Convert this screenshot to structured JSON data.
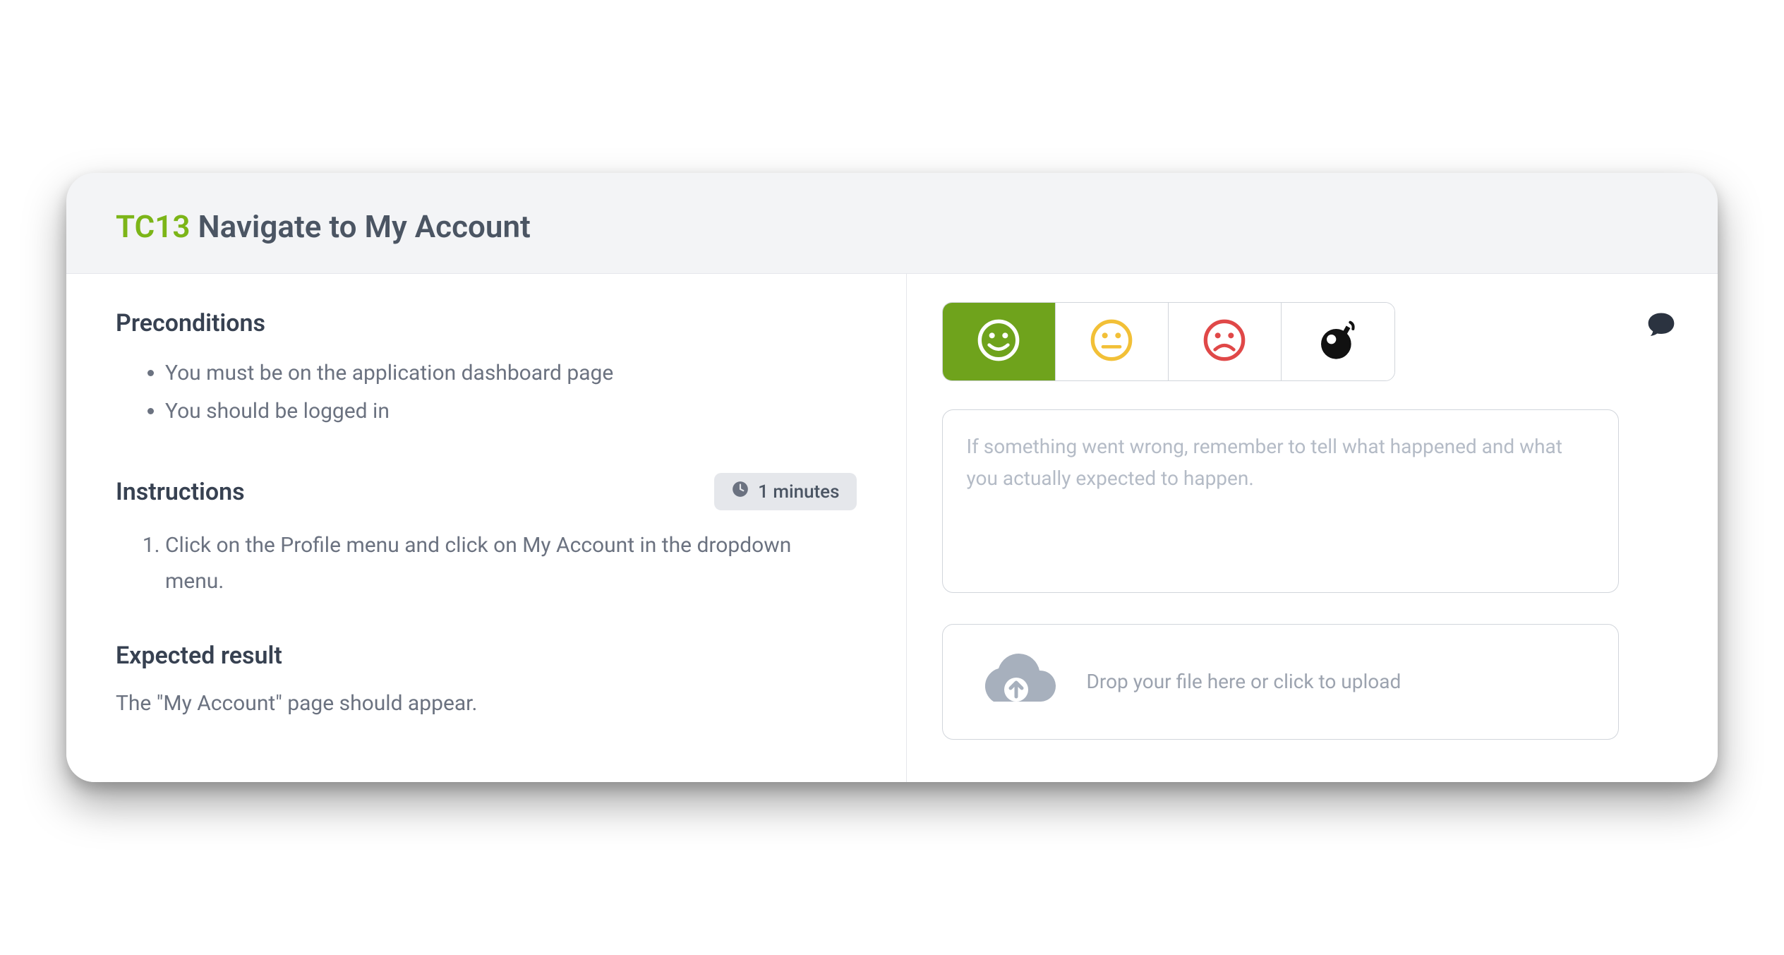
{
  "header": {
    "tc_id": "TC13",
    "title": "Navigate to My Account"
  },
  "left": {
    "preconditions_heading": "Preconditions",
    "preconditions": [
      "You must be on the application dashboard page",
      "You should be logged in"
    ],
    "instructions_heading": "Instructions",
    "time_label": "1 minutes",
    "instructions": [
      "Click on the Profile menu and click on My Account in the dropdown menu."
    ],
    "expected_heading": "Expected result",
    "expected_text": "The \"My Account\" page should appear."
  },
  "right": {
    "ratings": [
      {
        "name": "pass",
        "icon": "smile",
        "active": true
      },
      {
        "name": "neutral",
        "icon": "neutral",
        "active": false
      },
      {
        "name": "fail",
        "icon": "frown",
        "active": false
      },
      {
        "name": "blocked",
        "icon": "bomb",
        "active": false
      }
    ],
    "comment_placeholder": "If something went wrong, remember to tell what happened and what you actually expected to happen.",
    "upload_text": "Drop your file here or click to upload"
  },
  "colors": {
    "accent_green": "#7cb518",
    "active_green": "#6fa31c",
    "yellow": "#f2c037",
    "red": "#e04848",
    "gray_icon": "#a7b0bd"
  }
}
